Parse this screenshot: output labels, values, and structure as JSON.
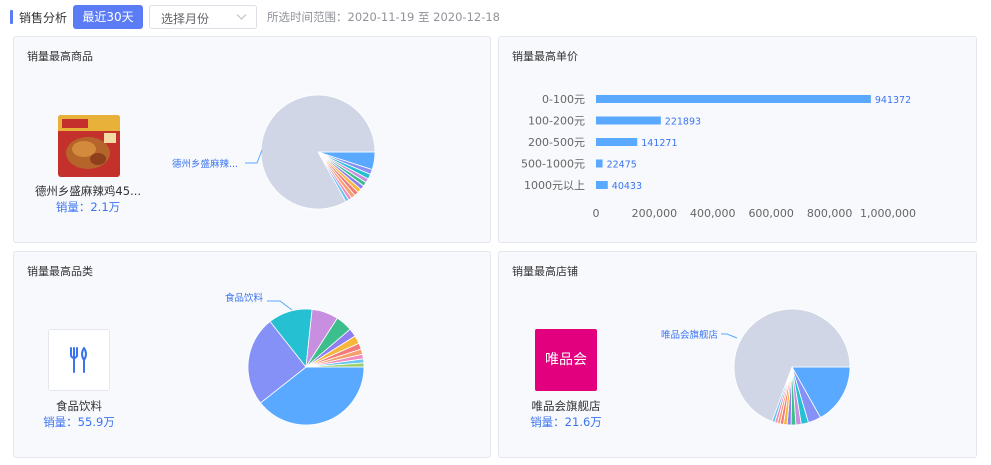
{
  "header": {
    "title": "销售分析",
    "recent_btn": "最近30天",
    "month_select": {
      "placeholder": "选择月份"
    },
    "range_label": "所选时间范围：",
    "range_start": "2020-11-19",
    "range_sep": "至",
    "range_end": "2020-12-18"
  },
  "colors": {
    "accent": "#5b7cf5",
    "sales_blue": "#3a74f0",
    "bar_blue": "#58a9ff",
    "pie_gray": "#d0d6e6",
    "vip_pink": "#e2007f"
  },
  "top_product": {
    "title": "销量最高商品",
    "name": "德州乡盛麻辣鸡45...",
    "sales": "销量：2.1万",
    "pie_label": "德州乡盛麻辣..."
  },
  "top_price": {
    "title": "销量最高单价"
  },
  "top_category": {
    "title": "销量最高品类",
    "icon": "utensils-icon",
    "name": "食品饮料",
    "sales": "销量：55.9万",
    "pie_label": "食品饮料"
  },
  "top_shop": {
    "title": "销量最高店铺",
    "logo_text": "唯品会",
    "name": "唯品会旗舰店",
    "sales": "销量：21.6万",
    "pie_label": "唯品会旗舰店"
  },
  "chart_data": [
    {
      "type": "pie",
      "id": "product-pie",
      "labels": [
        "德州乡盛麻辣..."
      ],
      "values": [
        2.1,
        0.6,
        0.6,
        0.5,
        0.5,
        0.5,
        0.5,
        0.5,
        0.5,
        0.4,
        0.4,
        35.0
      ]
    },
    {
      "type": "bar",
      "id": "price-bar",
      "orientation": "horizontal",
      "categories": [
        "0-100元",
        "100-200元",
        "200-500元",
        "500-1000元",
        "1000元以上"
      ],
      "values": [
        941372,
        221893,
        141271,
        22475,
        40433
      ],
      "xlim": [
        0,
        1000000
      ],
      "xticks": [
        "0",
        "200,000",
        "400,000",
        "600,000",
        "800,000",
        "1,000,000"
      ],
      "grid": false
    },
    {
      "type": "pie",
      "id": "category-pie",
      "labels": [
        "食品饮料"
      ],
      "values": [
        55.9,
        35.5,
        17.5,
        10.5,
        6.6,
        3.3,
        3.2,
        2.4,
        2.1,
        1.8,
        1.6,
        1.6
      ]
    },
    {
      "type": "pie",
      "id": "shop-pie",
      "labels": [
        "唯品会旗舰店"
      ],
      "values": [
        21.6,
        4.6,
        2.6,
        1.9,
        1.7,
        1.4,
        1.3,
        1.2,
        1.0,
        1.0,
        1.0,
        89.0
      ]
    }
  ]
}
